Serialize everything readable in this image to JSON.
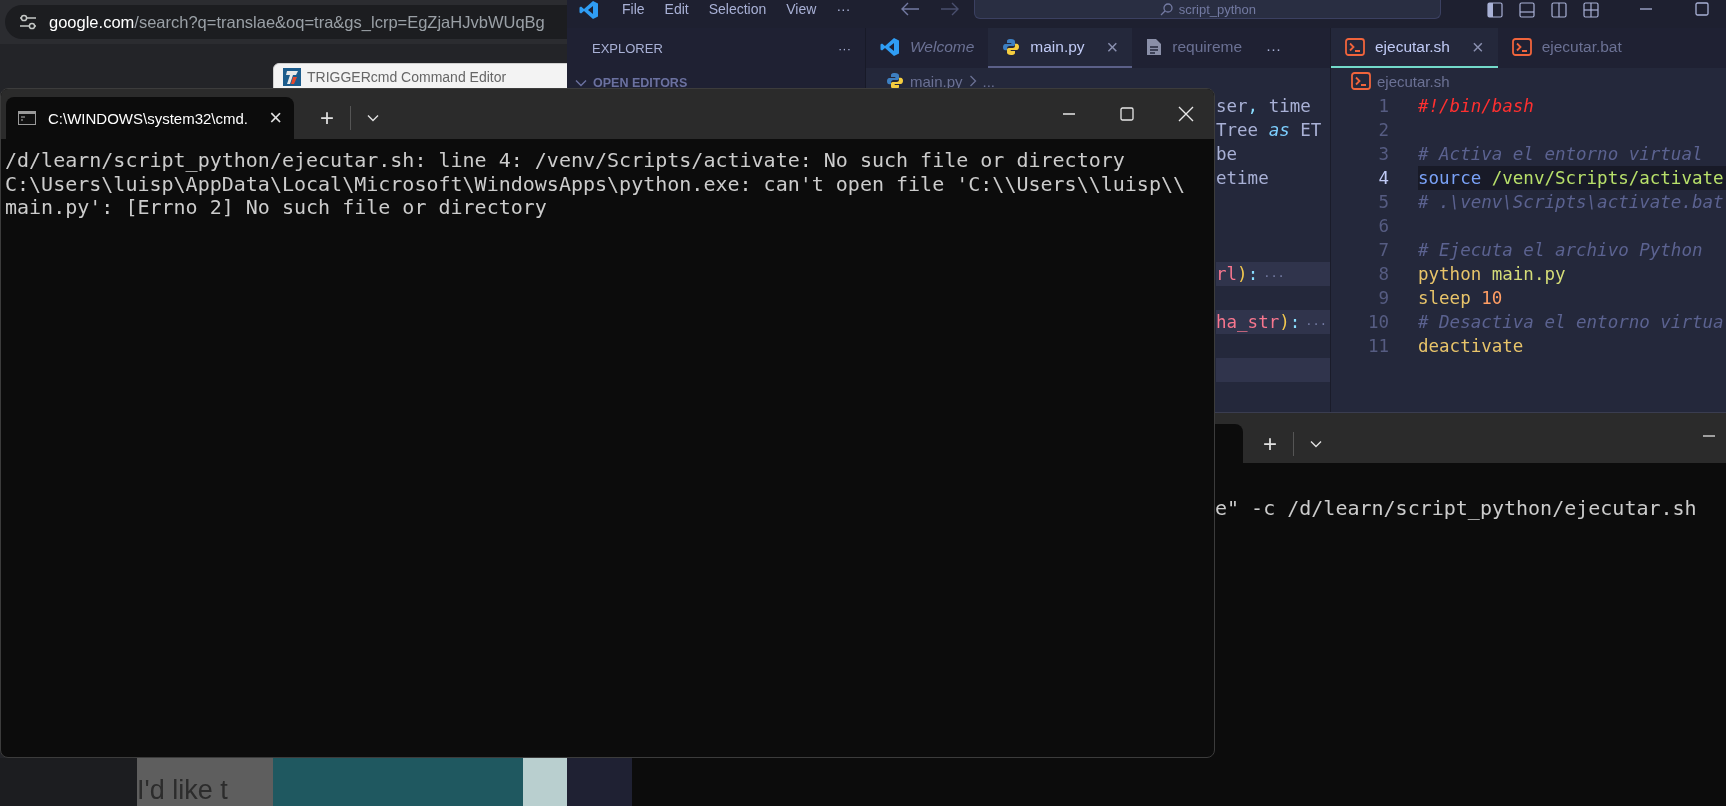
{
  "browser": {
    "address": {
      "domain": "google.com",
      "path": "/search?q=translae&oq=tra&gs_lcrp=EgZjaHJvbWUqBg"
    },
    "background_window": {
      "title": "TRIGGERcmd Command Editor"
    },
    "page_text": "I'd like t"
  },
  "vscode": {
    "menu": [
      "File",
      "Edit",
      "Selection",
      "View",
      "···"
    ],
    "search": "script_python",
    "sidebar": {
      "title": "EXPLORER",
      "more": "···",
      "section": "OPEN EDITORS"
    },
    "groups": [
      {
        "active": false,
        "overflow": "···",
        "tabs": [
          {
            "label": "Welcome",
            "kind": "vscode",
            "selected": false,
            "preview": true
          },
          {
            "label": "main.py",
            "kind": "python",
            "selected": true,
            "preview": false,
            "close": "×"
          },
          {
            "label": "requireme",
            "kind": "file",
            "selected": false,
            "preview": false
          }
        ],
        "breadcrumb": {
          "file": "main.py",
          "kind": "python",
          "more": "..."
        },
        "rows": [
          {
            "kind": "code",
            "tokens": [
              {
                "text": "ser",
                "kind": "plain"
              },
              {
                "text": ",",
                "kind": "punct"
              },
              {
                "text": " time",
                "kind": "plain"
              }
            ]
          },
          {
            "kind": "code",
            "tokens": [
              {
                "text": "Tree ",
                "kind": "plain"
              },
              {
                "text": "as",
                "kind": "keyword"
              },
              {
                "text": " ET",
                "kind": "plain"
              }
            ]
          },
          {
            "kind": "code",
            "tokens": [
              {
                "text": "be",
                "kind": "plain"
              }
            ]
          },
          {
            "kind": "code",
            "tokens": [
              {
                "text": "etime",
                "kind": "plain"
              }
            ]
          },
          {
            "kind": "blank"
          },
          {
            "kind": "blank"
          },
          {
            "kind": "blank"
          },
          {
            "kind": "folded",
            "tokens": [
              {
                "text": "rl",
                "kind": "name"
              },
              {
                "text": ")",
                "kind": "paren"
              },
              {
                "text": ":",
                "kind": "punct"
              },
              {
                "text": "···",
                "kind": "fold"
              }
            ]
          },
          {
            "kind": "blank"
          },
          {
            "kind": "folded",
            "tokens": [
              {
                "text": "ha_str",
                "kind": "name"
              },
              {
                "text": ")",
                "kind": "paren"
              },
              {
                "text": ":",
                "kind": "punct"
              },
              {
                "text": "···",
                "kind": "fold"
              }
            ]
          },
          {
            "kind": "blank"
          },
          {
            "kind": "highlight"
          }
        ]
      },
      {
        "active": true,
        "tabs": [
          {
            "label": "ejecutar.sh",
            "kind": "shell",
            "selected": true,
            "preview": false,
            "close": "×"
          },
          {
            "label": "ejecutar.bat",
            "kind": "shell",
            "selected": false,
            "preview": false
          }
        ],
        "breadcrumb": {
          "file": "ejecutar.sh",
          "kind": "shell"
        },
        "rows": [
          {
            "number": "1",
            "current": false,
            "tokens": [
              {
                "text": "#!/bin/bash",
                "kind": "shebang"
              }
            ]
          },
          {
            "number": "2",
            "current": false
          },
          {
            "number": "3",
            "current": false,
            "tokens": [
              {
                "text": "# Activa el entorno virtual",
                "kind": "comment"
              }
            ]
          },
          {
            "number": "4",
            "current": true,
            "tokens": [
              {
                "text": "source",
                "kind": "builtin"
              },
              {
                "text": " /venv/Scripts/activate",
                "kind": "path"
              }
            ]
          },
          {
            "number": "5",
            "current": false,
            "tokens": [
              {
                "text": "# .\\venv\\Scripts\\activate.bat",
                "kind": "comment"
              }
            ]
          },
          {
            "number": "6",
            "current": false
          },
          {
            "number": "7",
            "current": false,
            "tokens": [
              {
                "text": "# Ejecuta el archivo Python",
                "kind": "comment"
              }
            ]
          },
          {
            "number": "8",
            "current": false,
            "tokens": [
              {
                "text": "python",
                "kind": "command"
              },
              {
                "text": " main.py",
                "kind": "argument"
              }
            ]
          },
          {
            "number": "9",
            "current": false,
            "tokens": [
              {
                "text": "sleep",
                "kind": "command"
              },
              {
                "text": " 10",
                "kind": "number"
              }
            ]
          },
          {
            "number": "10",
            "current": false,
            "tokens": [
              {
                "text": "# Desactiva el entorno virtua",
                "kind": "comment"
              }
            ]
          },
          {
            "number": "11",
            "current": false,
            "tokens": [
              {
                "text": "deactivate",
                "kind": "command"
              }
            ]
          }
        ]
      }
    ]
  },
  "terminal": {
    "new_tab": "+",
    "line": "e\" -c /d/learn/script_python/ejecutar.sh"
  },
  "cmd": {
    "tab": {
      "title": "C:\\WINDOWS\\system32\\cmd.",
      "close": "×"
    },
    "new_tab": "+",
    "output": [
      "/d/learn/script_python/ejecutar.sh: line 4: /venv/Scripts/activate: No such file or directory",
      "C:\\Users\\luisp\\AppData\\Local\\Microsoft\\WindowsApps\\python.exe: can't open file 'C:\\\\Users\\\\luisp\\\\",
      "main.py': [Errno 2] No such file or directory"
    ]
  }
}
